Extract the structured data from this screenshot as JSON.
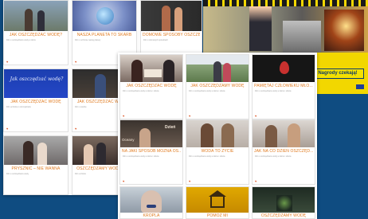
{
  "back_panel": {
    "cards": [
      {
        "title": "JAK OSZCZĘDZAĆ WODĘ?",
        "desc": "Film o oszczędzaniu wody w domu"
      },
      {
        "title": "NASZA PLANETA TO SKARB",
        "desc": "Film o ochronie naszej planety"
      },
      {
        "title": "DOMOWE SPOSOBY OSZCZĘ...",
        "desc": "Film o domowych sposobach"
      },
      {
        "title": "JAK OSZCZĘDZAĆ WODĘ",
        "desc": "Film uczniów o oszczędzaniu"
      },
      {
        "title": "JAK OSZCZĘDZAĆ W...",
        "desc": "Film o wodzie"
      },
      {
        "title": "PRYSZNIC – NIE WANNA",
        "desc": "Film o oszczędzaniu wody"
      },
      {
        "title": "OSZCZĘDZAMY WODĘ!",
        "desc": "Film uczniów"
      }
    ],
    "thumb_text": "Jak oszczędzać wodę?"
  },
  "front_panel": {
    "cards": [
      {
        "title": "JAK OSZCZĘDZAĆ WODĘ",
        "desc": "Film o oszczędzaniu wody w domu i szkole"
      },
      {
        "title": "JAK OSZCZĘDZAMY WODĘ",
        "desc": "Film o oszczędzaniu wody w domu i szkole"
      },
      {
        "title": "PAMIĘTAJ CZŁOWIEKU MŁO...",
        "desc": "Film o oszczędzaniu wody w domu i szkole"
      },
      {
        "title": "NA JAKI SPOSÓB MOŻNA OS...",
        "desc": "Film o oszczędzaniu wody w domu i szkole"
      },
      {
        "title": "WODA TO ŻYCIE",
        "desc": "Film o oszczędzaniu wody w domu i szkole"
      },
      {
        "title": "JAK NA CO DZIEŃ OSZCZĘD...",
        "desc": "Film o oszczędzaniu wody w domu i szkole"
      },
      {
        "title": "KROPLA",
        "desc": ""
      },
      {
        "title": "POMÓŻ MI",
        "desc": ""
      },
      {
        "title": "OSZCZĘDZAMY WODĘ",
        "desc": ""
      }
    ],
    "thumb_words": [
      "Dzień",
      "Oceany"
    ]
  },
  "banner": {
    "prize_button": "Nagrody czekają!"
  },
  "colors": {
    "page_bg": "#0f4c81",
    "title_orange": "#e07a1f",
    "banner_yellow": "#f2d700"
  }
}
